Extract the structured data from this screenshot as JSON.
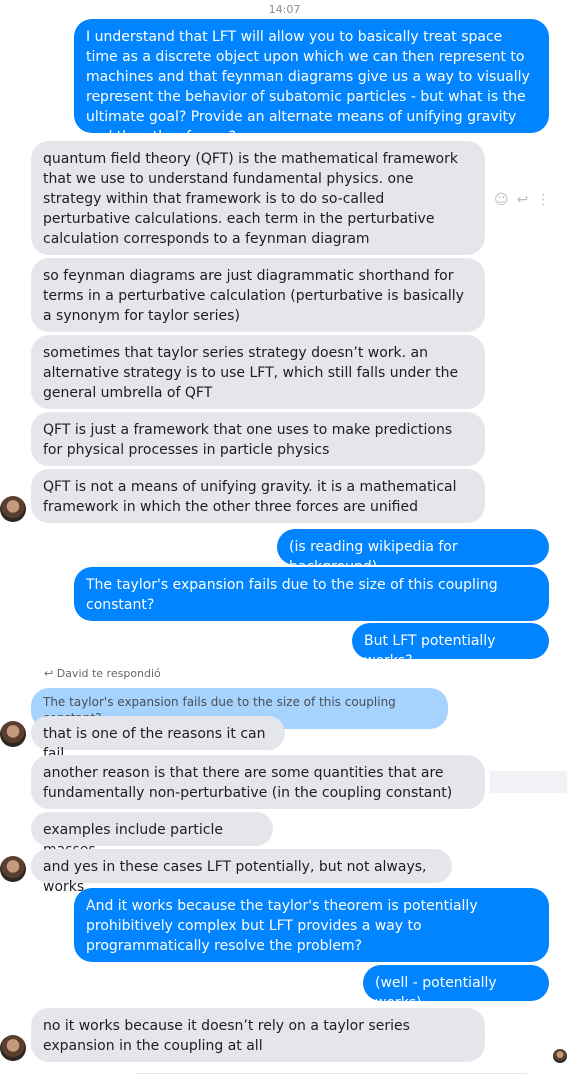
{
  "timestamp": "14:07",
  "messages": [
    {
      "text": "I understand that LFT will allow you to basically treat space time as a discrete object upon which we can then represent to machines and that feynman diagrams give us a way to visually represent the behavior of subatomic particles - but what is the ultimate goal? Provide an alternate means of unifying gravity and the other forces?"
    },
    {
      "text": "quantum field theory (QFT) is the mathematical framework that we use to understand fundamental physics. one strategy within that framework is to do so-called perturbative calculations. each term in the perturbative calculation corresponds to a feynman diagram"
    },
    {
      "text": "so feynman diagrams are just diagrammatic shorthand for terms in a perturbative calculation (perturbative is basically a synonym for taylor series)"
    },
    {
      "text": "sometimes that taylor series strategy doesn’t work. an alternative strategy is to use LFT, which still falls under the general umbrella of QFT"
    },
    {
      "text": "QFT is just a framework that one uses to make predictions for physical processes in particle physics"
    },
    {
      "text": "QFT is not a means of unifying gravity. it is a mathematical framework in which the other three forces are unified"
    },
    {
      "text": "(is reading wikipedia for background)"
    },
    {
      "text": "The taylor's expansion fails due to the size of this coupling constant?"
    },
    {
      "text": "But LFT potentially works?"
    },
    {
      "text": "that is one of the reasons it can fail"
    },
    {
      "text": "another reason is that there are some quantities that are fundamentally non-perturbative (in the coupling constant)"
    },
    {
      "text": "examples include particle masses"
    },
    {
      "text": "and yes in these cases LFT potentially, but not always, works"
    },
    {
      "text": "And it works because the taylor's theorem is potentially prohibitively complex but LFT provides a way to programmatically resolve the problem?"
    },
    {
      "text": "(well - potentially works)"
    },
    {
      "text": "no it works because it doesn’t rely on a taylor series expansion in the coupling at all"
    }
  ],
  "reply_header": {
    "label": "David te respondió",
    "quoted_text": "The taylor's expansion fails due to the size of this coupling constant?"
  },
  "icons": {
    "smile": "☺",
    "reply": "↩",
    "more": "⋮"
  },
  "colors": {
    "outgoing": "#0084ff",
    "incoming": "#e4e6eb",
    "quote": "#a7d3ff"
  }
}
